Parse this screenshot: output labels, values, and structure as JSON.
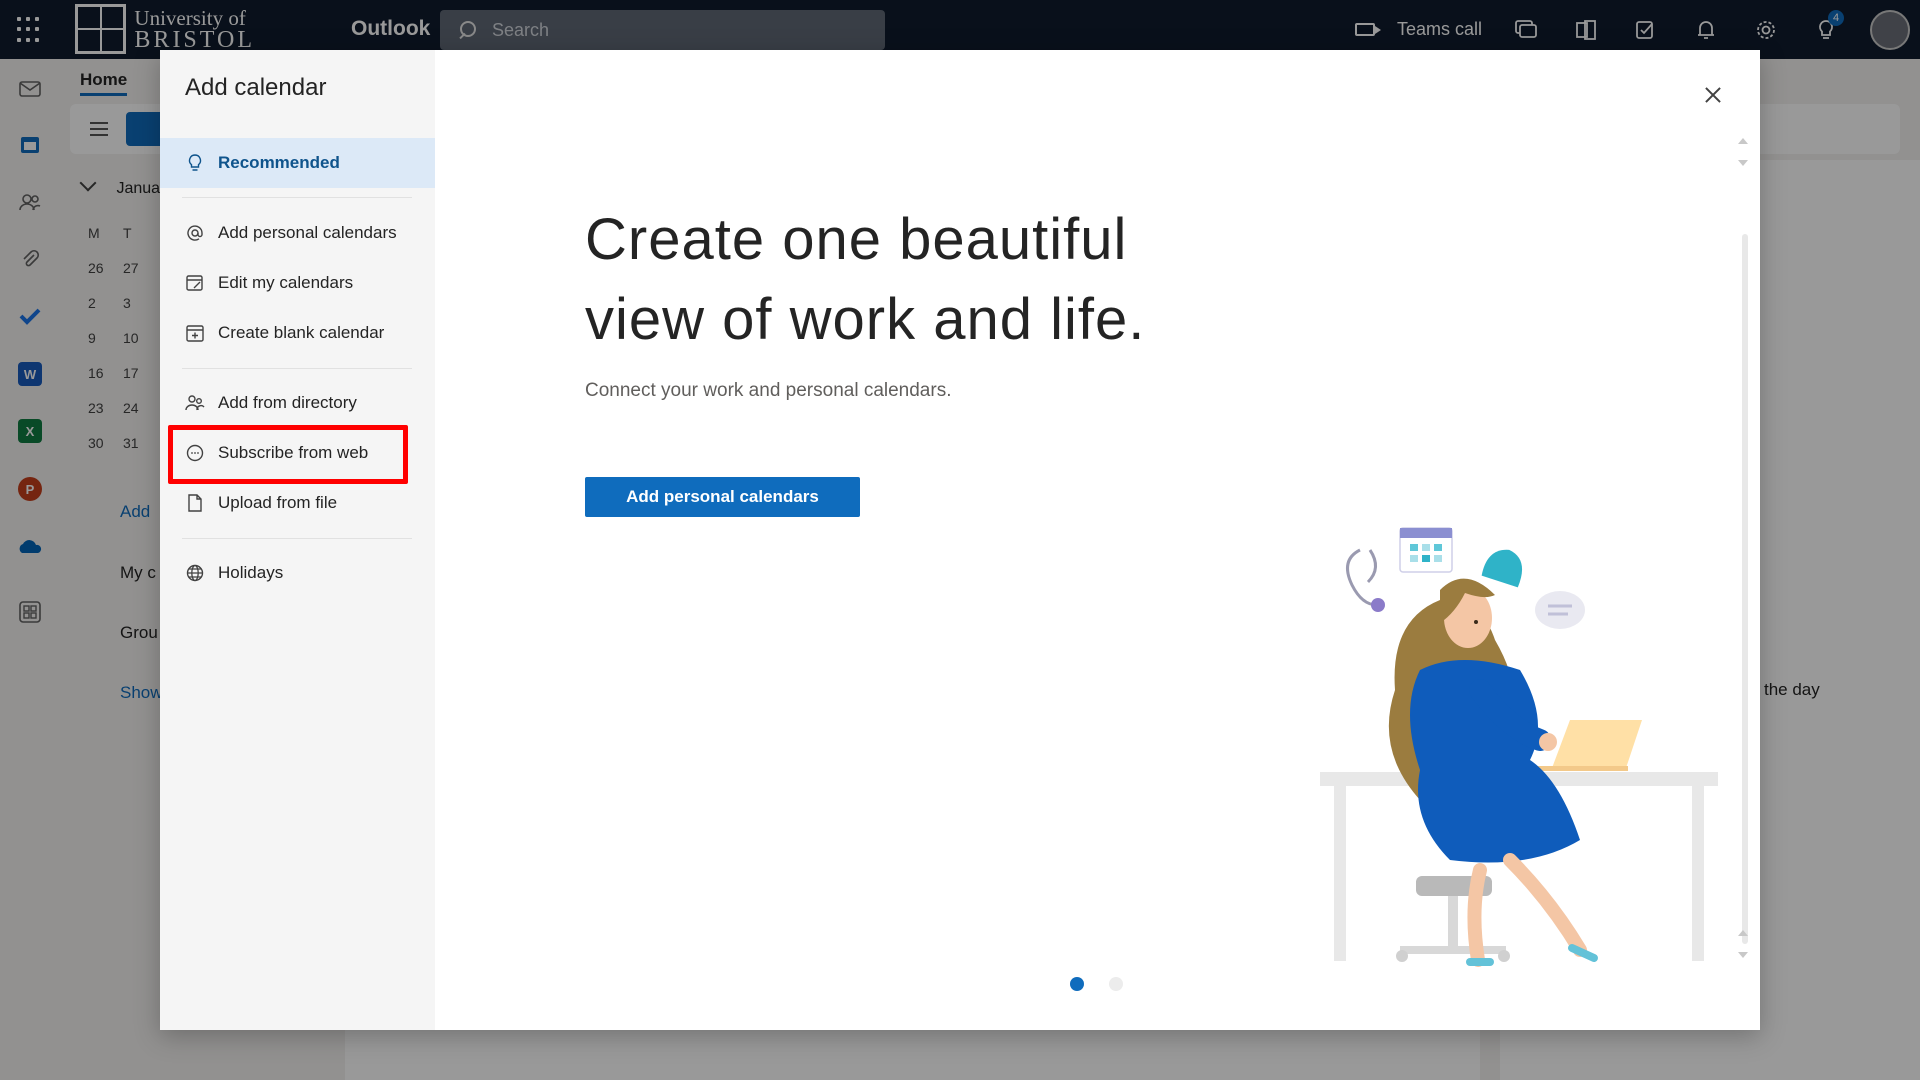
{
  "topbar": {
    "logo_line1": "University of",
    "logo_line2": "BRISTOL",
    "app_name": "Outlook",
    "search_placeholder": "Search",
    "teams_call": "Teams call",
    "notifications_badge": "4"
  },
  "background": {
    "home_tab": "Home",
    "mini_month": "Janua",
    "weekday_headers": [
      "M",
      "T"
    ],
    "mini_days": [
      "26",
      "27",
      "2",
      "3",
      "9",
      "10",
      "16",
      "17",
      "23",
      "24",
      "30",
      "31"
    ],
    "add_link": "Add",
    "my_calendars": "My c",
    "groups": "Grou",
    "show": "Show",
    "right_panel_text": "the day"
  },
  "dialog": {
    "title": "Add calendar",
    "side_items": [
      {
        "label": "Recommended",
        "icon": "lightbulb-icon"
      },
      {
        "label": "Add personal calendars",
        "icon": "at-sign-icon"
      },
      {
        "label": "Edit my calendars",
        "icon": "edit-calendar-icon"
      },
      {
        "label": "Create blank calendar",
        "icon": "add-calendar-icon"
      },
      {
        "label": "Add from directory",
        "icon": "people-icon"
      },
      {
        "label": "Subscribe from web",
        "icon": "subscribe-icon"
      },
      {
        "label": "Upload from file",
        "icon": "file-icon"
      },
      {
        "label": "Holidays",
        "icon": "globe-icon"
      }
    ],
    "headline_line1": "Create one beautiful",
    "headline_line2": "view of work and life.",
    "subline": "Connect your work and personal calendars.",
    "cta_label": "Add personal calendars",
    "carousel_active": 1,
    "carousel_total": 2
  },
  "colors": {
    "accent": "#0f6cbd",
    "topbar": "#0f1b2d",
    "highlight": "#ff0000",
    "active_item_bg": "#dce9f7"
  }
}
